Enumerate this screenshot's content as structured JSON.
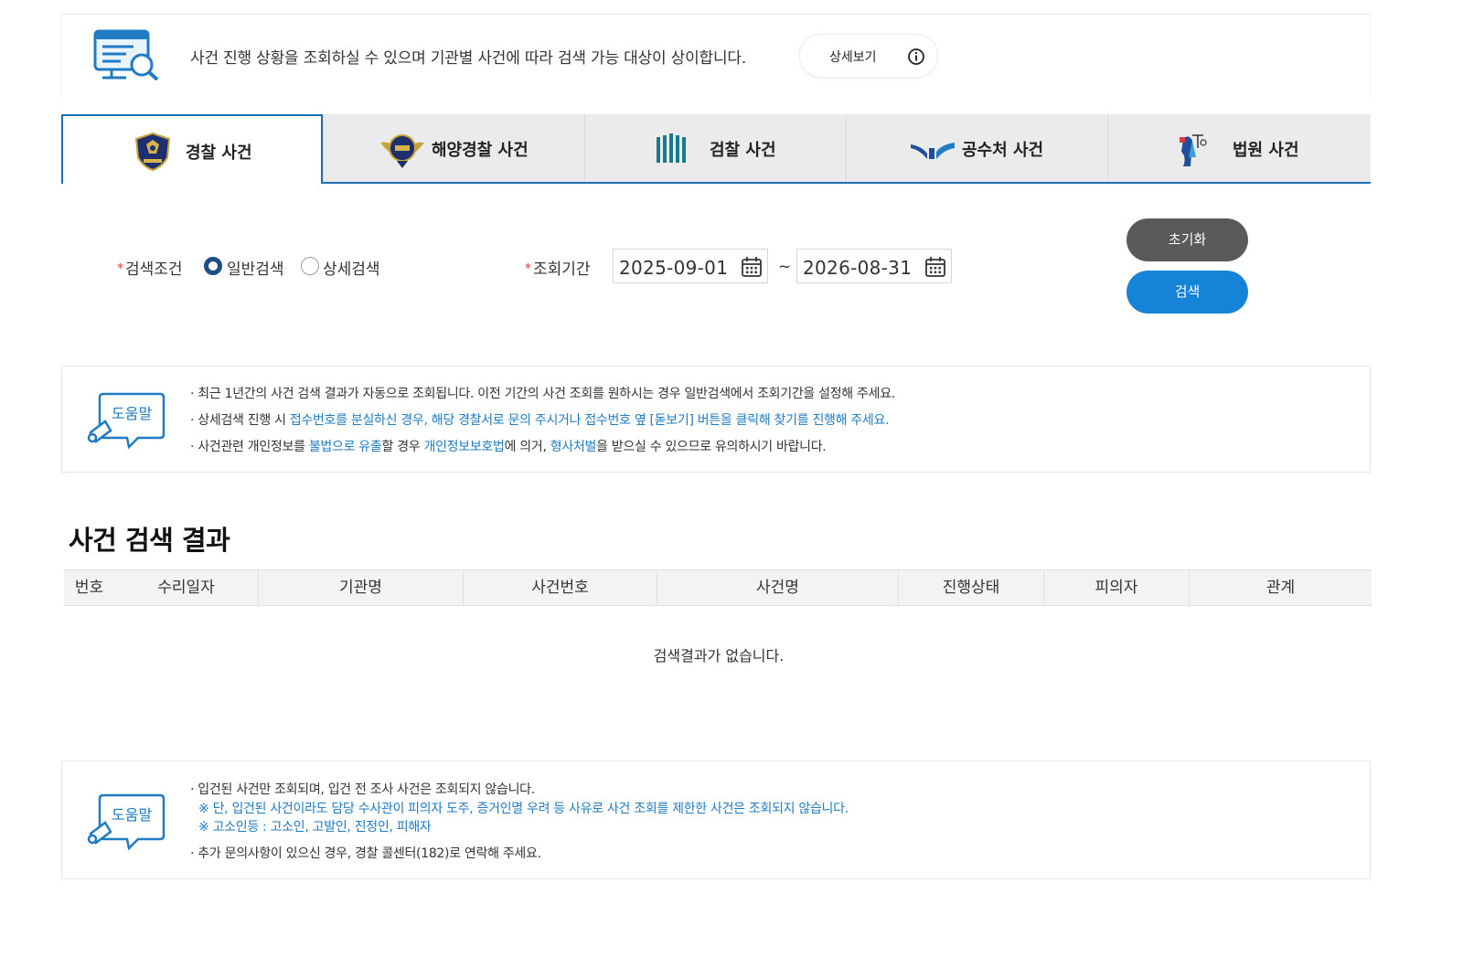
{
  "notice": {
    "text": "사건 진행 상황을 조회하실 수 있으며 기관별 사건에 따라 검색 가능 대상이 상이합니다.",
    "detail_button": "상세보기"
  },
  "tabs": [
    {
      "label": "경찰 사건",
      "icon": "police-badge-icon",
      "active": true
    },
    {
      "label": "해양경찰 사건",
      "icon": "coast-guard-emblem-icon",
      "active": false
    },
    {
      "label": "검찰 사건",
      "icon": "prosecution-bars-icon",
      "active": false
    },
    {
      "label": "공수처 사건",
      "icon": "cio-logo-icon",
      "active": false
    },
    {
      "label": "법원 사건",
      "icon": "court-justice-icon",
      "active": false
    }
  ],
  "search": {
    "condition_label": "검색조건",
    "option_general": "일반검색",
    "option_detail": "상세검색",
    "selected": "일반검색",
    "period_label": "조회기간",
    "date_from": "2025-09-01",
    "date_to": "2026-08-31",
    "tilde": "~",
    "reset_button": "초기화",
    "search_button": "검색"
  },
  "help1": {
    "badge": "도움말",
    "line1": "· 최근 1년간의 사건 검색 결과가 자동으로 조회됩니다. 이전 기간의 사건 조회를 원하시는 경우 일반검색에서 조회기간을 설정해 주세요.",
    "line2_prefix": "· 상세검색 진행 시 ",
    "line2_blue": "접수번호를 분실하신 경우, 해당 경찰서로 문의 주시거나 접수번호 옆 [돋보기] 버튼을 클릭해 찾기를 진행해 주세요.",
    "line3_a": "· 사건관련 개인정보를 ",
    "line3_b": "불법으로 유출",
    "line3_c": "할 경우 ",
    "line3_d": "개인정보보호법",
    "line3_e": "에 의거, ",
    "line3_f": "형사처벌",
    "line3_g": "을 받으실 수 있으므로 유의하시기 바랍니다."
  },
  "results": {
    "title": "사건 검색 결과",
    "columns": [
      "번호",
      "수리일자",
      "기관명",
      "사건번호",
      "사건명",
      "진행상태",
      "피의자",
      "관계"
    ],
    "empty": "검색결과가 없습니다."
  },
  "help2": {
    "badge": "도움말",
    "line1": "· 입건된 사건만 조회되며, 입건 전 조사 사건은 조회되지 않습니다.",
    "line2": "※ 단, 입건된 사건이라도 담당 수사관이 피의자 도주, 증거인멸 우려 등 사유로 사건 조회를 제한한 사건은 조회되지 않습니다.",
    "line3": "※ 고소인등 : 고소인, 고발인, 진정인, 피해자",
    "line4": "· 추가 문의사항이 있으신 경우, 경찰 콜센터(182)로 연락해 주세요."
  },
  "colors": {
    "accent_blue": "#1583d6",
    "tab_border": "#1f6fb4",
    "reset_gray": "#595959",
    "required_red": "#e03a3a"
  }
}
